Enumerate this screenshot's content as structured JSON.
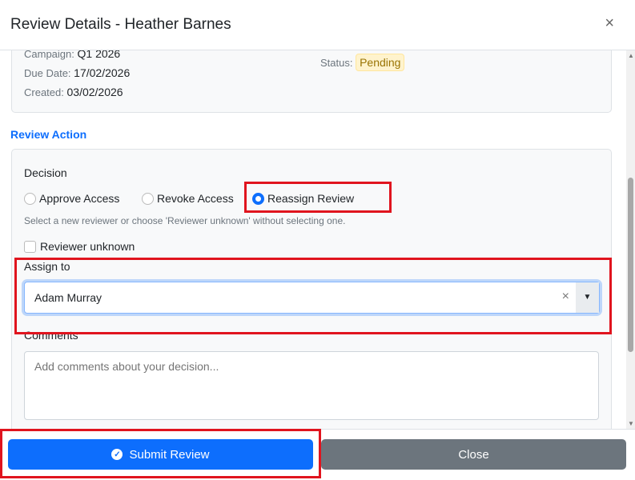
{
  "header": {
    "title": "Review Details - Heather Barnes",
    "close": "×"
  },
  "info": {
    "campaign_label": "Campaign:",
    "campaign": "Q1 2026",
    "due_label": "Due Date:",
    "due": "17/02/2026",
    "created_label": "Created:",
    "created": "03/02/2026",
    "status_label": "Status:",
    "status": "Pending"
  },
  "section_title": "Review Action",
  "form": {
    "decision_label": "Decision",
    "options": [
      "Approve Access",
      "Revoke Access",
      "Reassign Review"
    ],
    "selected": "Reassign Review",
    "help": "Select a new reviewer or choose 'Reviewer unknown' without selecting one.",
    "reviewer_unknown": "Reviewer unknown",
    "assign_label": "Assign to",
    "assign_value": "Adam Murray",
    "clear": "×",
    "arrow": "▼",
    "comments_label": "Comments",
    "comments_placeholder": "Add comments about your decision..."
  },
  "footer": {
    "submit": "Submit Review",
    "close": "Close"
  }
}
